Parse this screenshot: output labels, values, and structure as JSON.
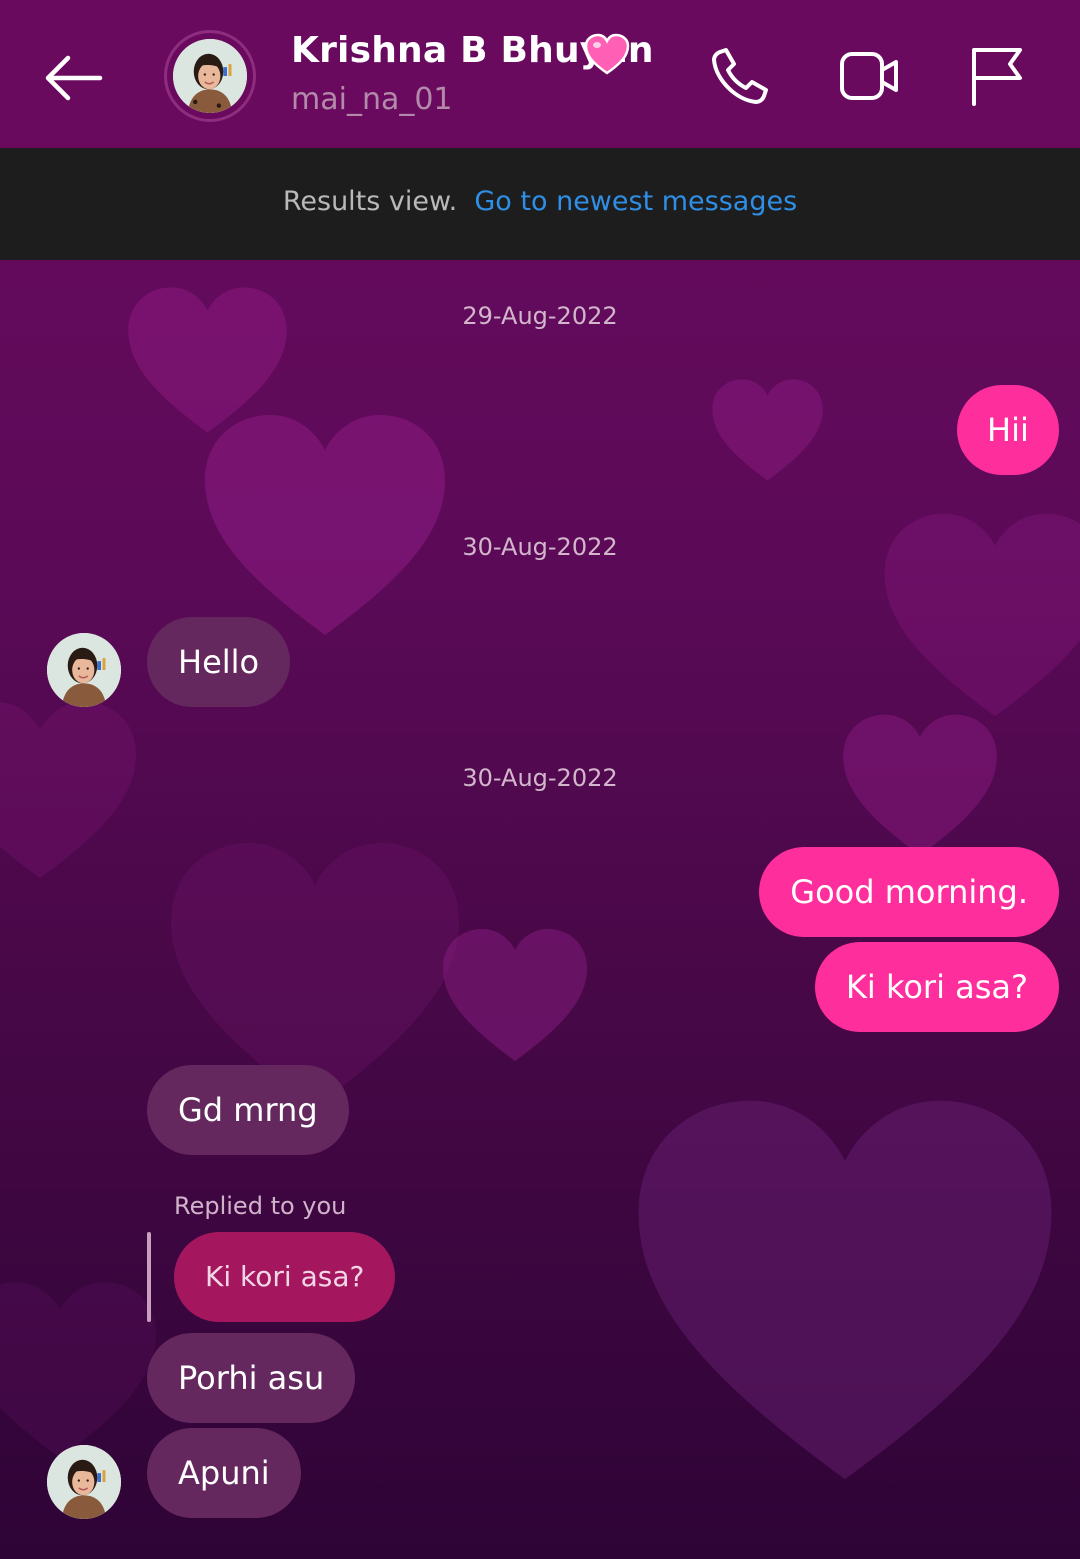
{
  "header": {
    "contact_name": "Krishna B Bhuyan",
    "username": "mai_na_01",
    "icons": [
      "back-arrow-icon",
      "phone-icon",
      "video-camera-icon",
      "flag-icon"
    ]
  },
  "banner": {
    "label": "Results view.",
    "link": "Go to newest messages"
  },
  "messages": {
    "date_1": "29-Aug-2022",
    "msg_hii": "Hii",
    "date_2": "30-Aug-2022",
    "msg_hello": "Hello",
    "date_3": "30-Aug-2022",
    "msg_good_morning": "Good morning.",
    "msg_ki_kori_asa": "Ki kori asa?",
    "msg_gd_mrng": "Gd mrng",
    "reply_label": "Replied to you",
    "reply_quote": "Ki kori asa?",
    "msg_porhi_asu": "Porhi asu",
    "msg_apuni": "Apuni"
  },
  "colors": {
    "header_bg": "#6a0a5f",
    "banner_bg": "#1d1d1d",
    "link": "#2f8fe6",
    "outgoing_bubble": "#ff2e9d",
    "incoming_bubble": "#64285e",
    "reply_quote_bubble": "#a4175f"
  }
}
